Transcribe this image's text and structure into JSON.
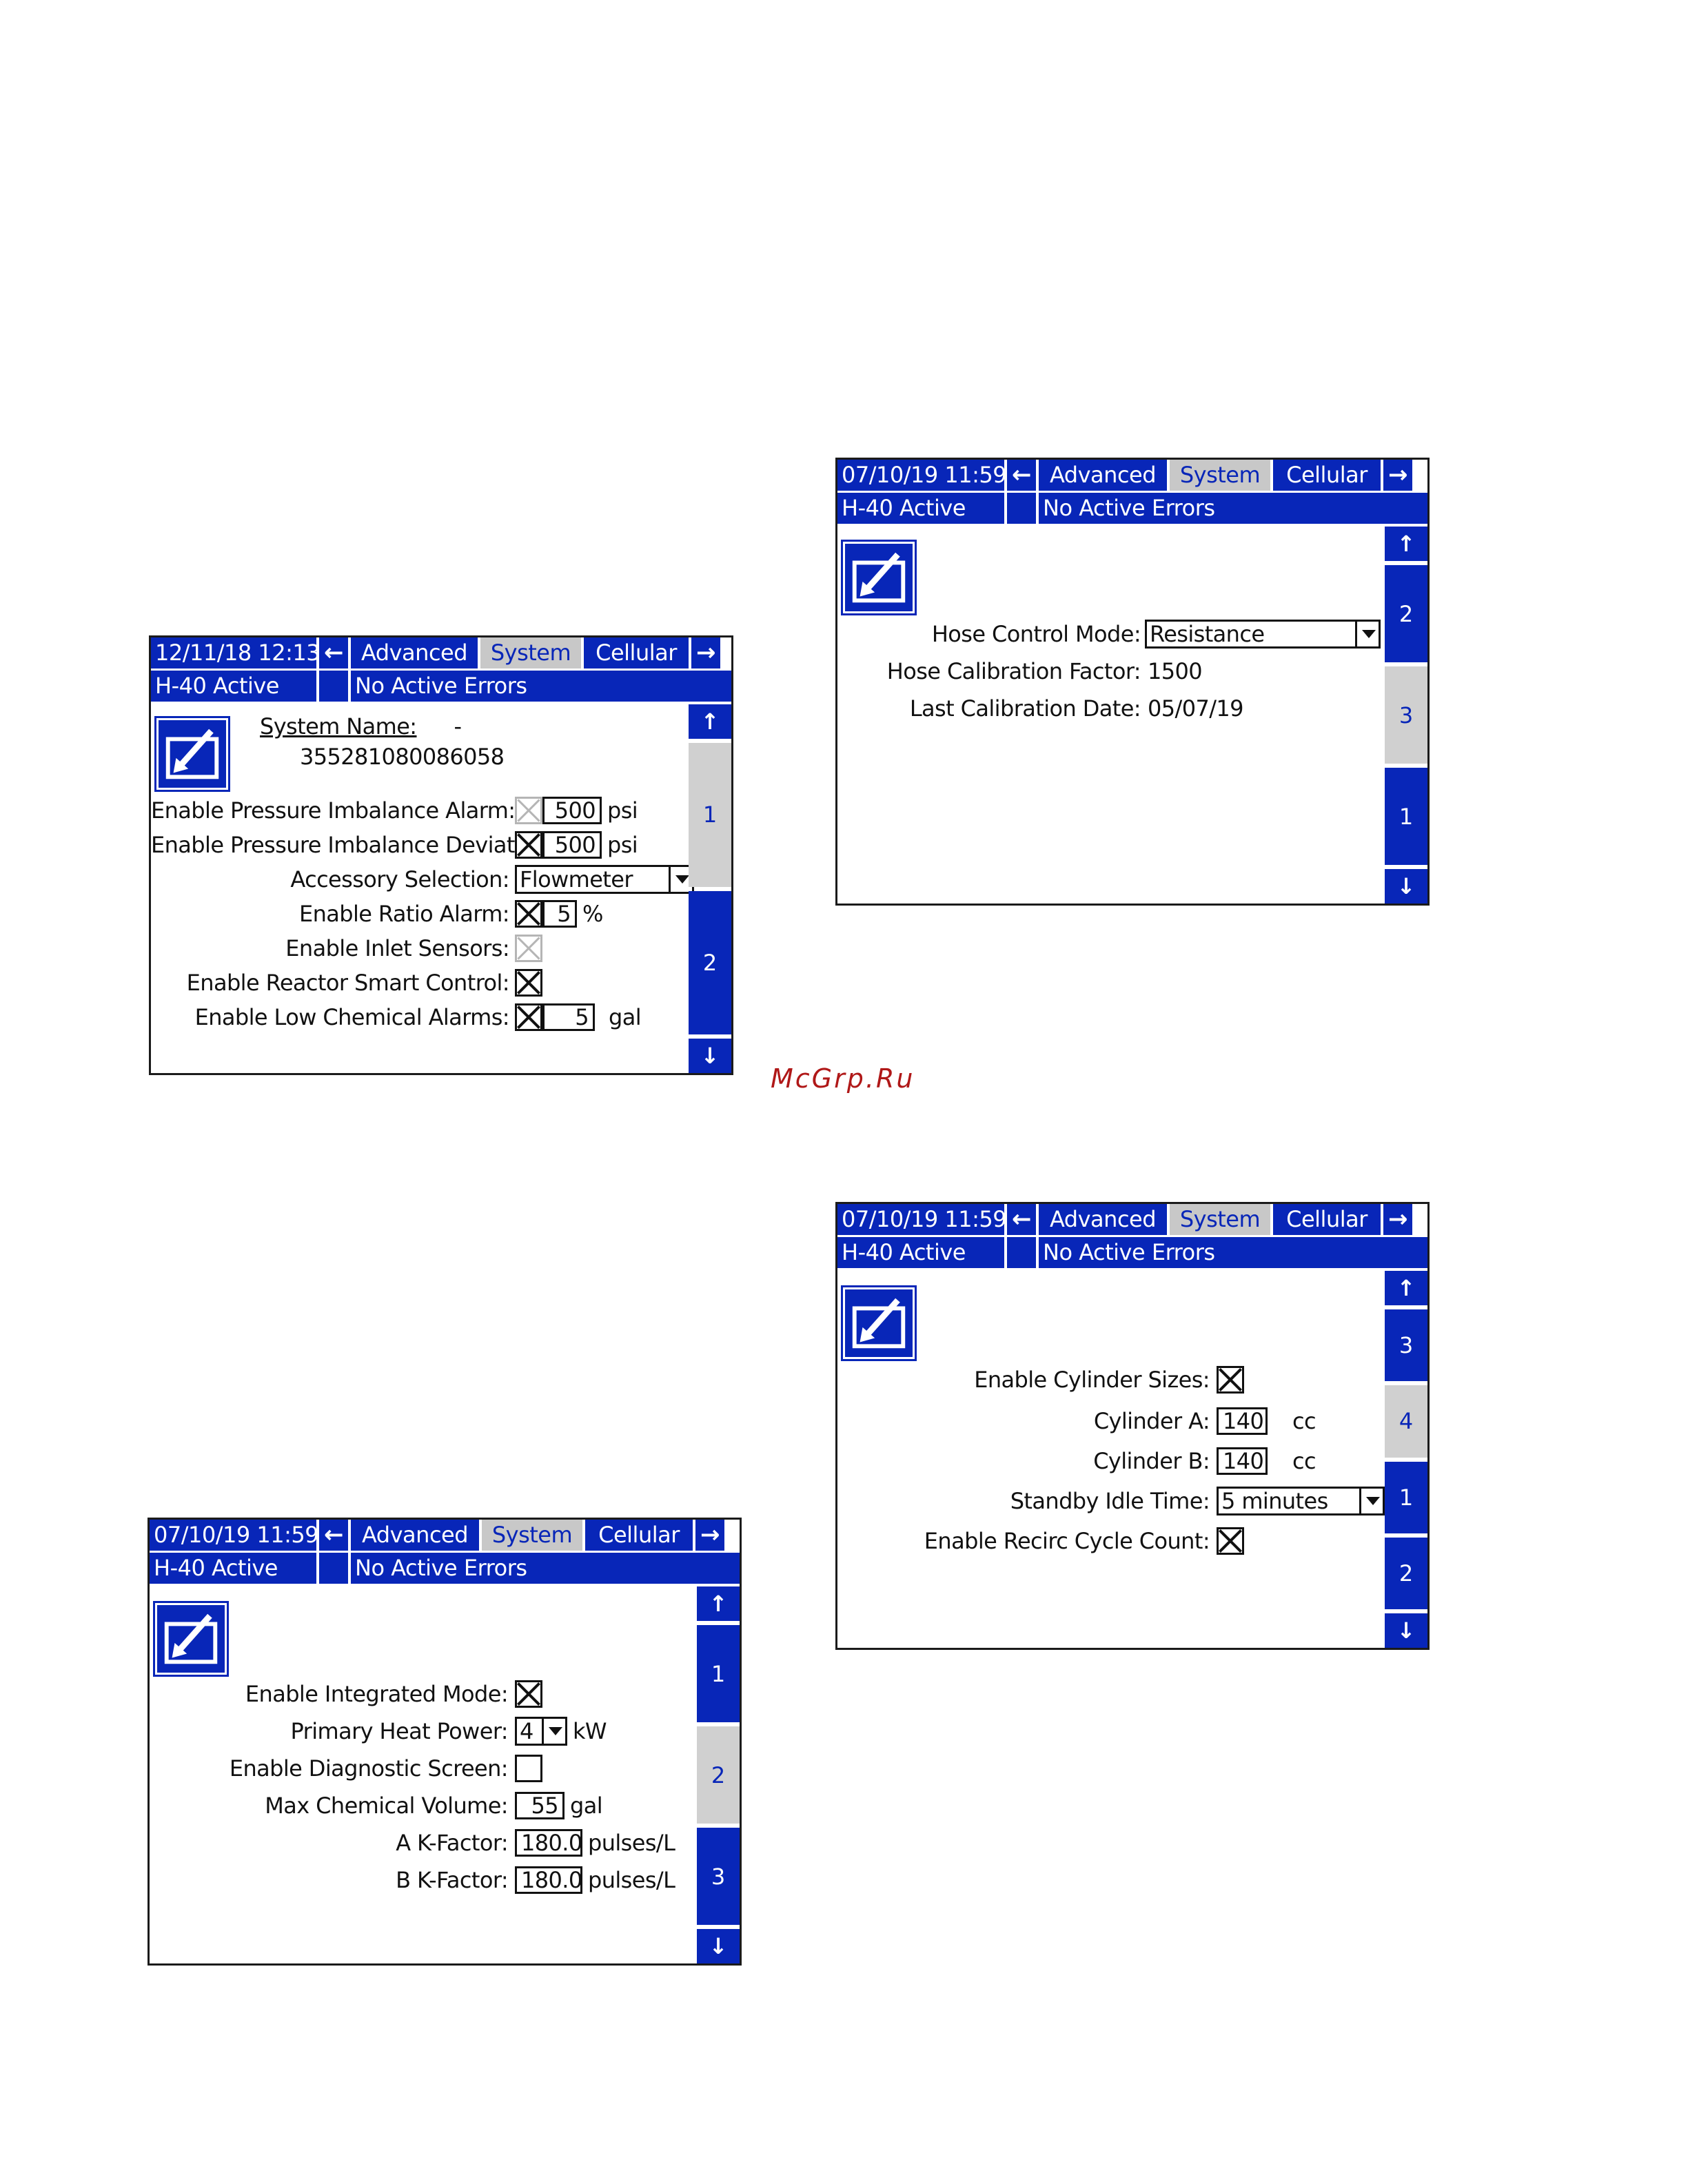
{
  "watermark": "McGrp.Ru",
  "screen_a": {
    "datetime": "12/11/18 12:13",
    "tabs": [
      "Advanced",
      "System",
      "Cellular"
    ],
    "selected_tab": "System",
    "status": "H-40 Active",
    "errors": "No Active Errors",
    "system_name_label": "System Name:",
    "system_name_value": "-",
    "serial": "355281080086058",
    "pages": [
      "1",
      "2"
    ],
    "selected_page": "1",
    "rows": {
      "pressure_alarm": {
        "label": "Enable Pressure Imbalance Alarm:",
        "value": "500",
        "unit": "psi"
      },
      "pressure_dev": {
        "label": "Enable Pressure Imbalance Deviation:",
        "value": "500",
        "unit": "psi"
      },
      "accessory": {
        "label": "Accessory Selection:",
        "value": "Flowmeter"
      },
      "ratio_alarm": {
        "label": "Enable Ratio Alarm:",
        "value": "5",
        "unit": "%"
      },
      "inlet": {
        "label": "Enable Inlet Sensors:"
      },
      "smart": {
        "label": "Enable Reactor Smart Control:"
      },
      "low_chem": {
        "label": "Enable Low Chemical Alarms:",
        "value": "5",
        "unit": "gal"
      }
    }
  },
  "screen_b": {
    "datetime": "07/10/19 11:59",
    "tabs": [
      "Advanced",
      "System",
      "Cellular"
    ],
    "selected_tab": "System",
    "status": "H-40 Active",
    "errors": "No Active Errors",
    "pages": [
      "2",
      "3",
      "1"
    ],
    "selected_page": "3",
    "rows": {
      "hose_mode": {
        "label": "Hose Control Mode:",
        "value": "Resistance"
      },
      "hose_cal": {
        "label": "Hose Calibration Factor:",
        "value": "1500"
      },
      "last_cal": {
        "label": "Last Calibration Date:",
        "value": "05/07/19"
      }
    }
  },
  "screen_c": {
    "datetime": "07/10/19 11:59",
    "tabs": [
      "Advanced",
      "System",
      "Cellular"
    ],
    "selected_tab": "System",
    "status": "H-40 Active",
    "errors": "No Active Errors",
    "pages": [
      "1",
      "2",
      "3"
    ],
    "selected_page": "2",
    "rows": {
      "integrated": {
        "label": "Enable Integrated Mode:"
      },
      "heat_power": {
        "label": "Primary Heat Power:",
        "value": "4",
        "unit": "kW"
      },
      "diag": {
        "label": "Enable Diagnostic Screen:"
      },
      "max_chem": {
        "label": "Max Chemical Volume:",
        "value": "55",
        "unit": "gal"
      },
      "a_kfactor": {
        "label": "A K-Factor:",
        "value": "180.0",
        "unit": "pulses/L"
      },
      "b_kfactor": {
        "label": "B K-Factor:",
        "value": "180.0",
        "unit": "pulses/L"
      }
    }
  },
  "screen_d": {
    "datetime": "07/10/19 11:59",
    "tabs": [
      "Advanced",
      "System",
      "Cellular"
    ],
    "selected_tab": "System",
    "status": "H-40 Active",
    "errors": "No Active Errors",
    "pages": [
      "3",
      "4",
      "1",
      "2"
    ],
    "selected_page": "4",
    "rows": {
      "cyl_sizes": {
        "label": "Enable Cylinder Sizes:"
      },
      "cyl_a": {
        "label": "Cylinder A:",
        "value": "140",
        "unit": "cc"
      },
      "cyl_b": {
        "label": "Cylinder B:",
        "value": "140",
        "unit": "cc"
      },
      "standby": {
        "label": "Standby Idle Time:",
        "value": "5 minutes"
      },
      "recirc": {
        "label": "Enable Recirc Cycle Count:"
      }
    }
  }
}
